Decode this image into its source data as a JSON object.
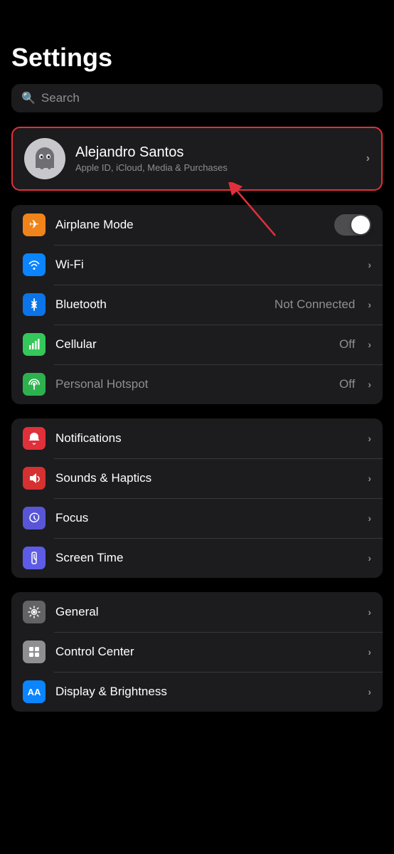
{
  "page": {
    "title": "Settings",
    "search": {
      "placeholder": "Search"
    }
  },
  "profile": {
    "name": "Alejandro Santos",
    "subtitle": "Apple ID, iCloud, Media & Purchases"
  },
  "connectivity": [
    {
      "id": "airplane-mode",
      "label": "Airplane Mode",
      "icon": "✈",
      "iconClass": "icon-orange",
      "control": "toggle",
      "toggleOn": false
    },
    {
      "id": "wifi",
      "label": "Wi-Fi",
      "icon": "wifi",
      "iconClass": "icon-blue",
      "control": "chevron",
      "value": ""
    },
    {
      "id": "bluetooth",
      "label": "Bluetooth",
      "icon": "bluetooth",
      "iconClass": "icon-blue-dark",
      "control": "chevron",
      "value": "Not Connected"
    },
    {
      "id": "cellular",
      "label": "Cellular",
      "icon": "cellular",
      "iconClass": "icon-green",
      "control": "chevron",
      "value": "Off"
    },
    {
      "id": "hotspot",
      "label": "Personal Hotspot",
      "icon": "hotspot",
      "iconClass": "icon-green-dark",
      "control": "chevron",
      "value": "Off",
      "labelDimmed": true
    }
  ],
  "notifications_group": [
    {
      "id": "notifications",
      "label": "Notifications",
      "icon": "bell",
      "iconClass": "icon-red",
      "control": "chevron"
    },
    {
      "id": "sounds",
      "label": "Sounds & Haptics",
      "icon": "speaker",
      "iconClass": "icon-red-medium",
      "control": "chevron"
    },
    {
      "id": "focus",
      "label": "Focus",
      "icon": "moon",
      "iconClass": "icon-purple",
      "control": "chevron"
    },
    {
      "id": "screentime",
      "label": "Screen Time",
      "icon": "hourglass",
      "iconClass": "icon-purple-indigo",
      "control": "chevron"
    }
  ],
  "general_group": [
    {
      "id": "general",
      "label": "General",
      "icon": "gear",
      "iconClass": "icon-gray",
      "control": "chevron"
    },
    {
      "id": "control-center",
      "label": "Control Center",
      "icon": "sliders",
      "iconClass": "icon-gray-light",
      "control": "chevron"
    },
    {
      "id": "display",
      "label": "Display & Brightness",
      "icon": "AA",
      "iconClass": "icon-blue",
      "control": "chevron"
    }
  ],
  "labels": {
    "search_icon": "🔍",
    "chevron": "›",
    "not_connected": "Not Connected",
    "off": "Off"
  }
}
